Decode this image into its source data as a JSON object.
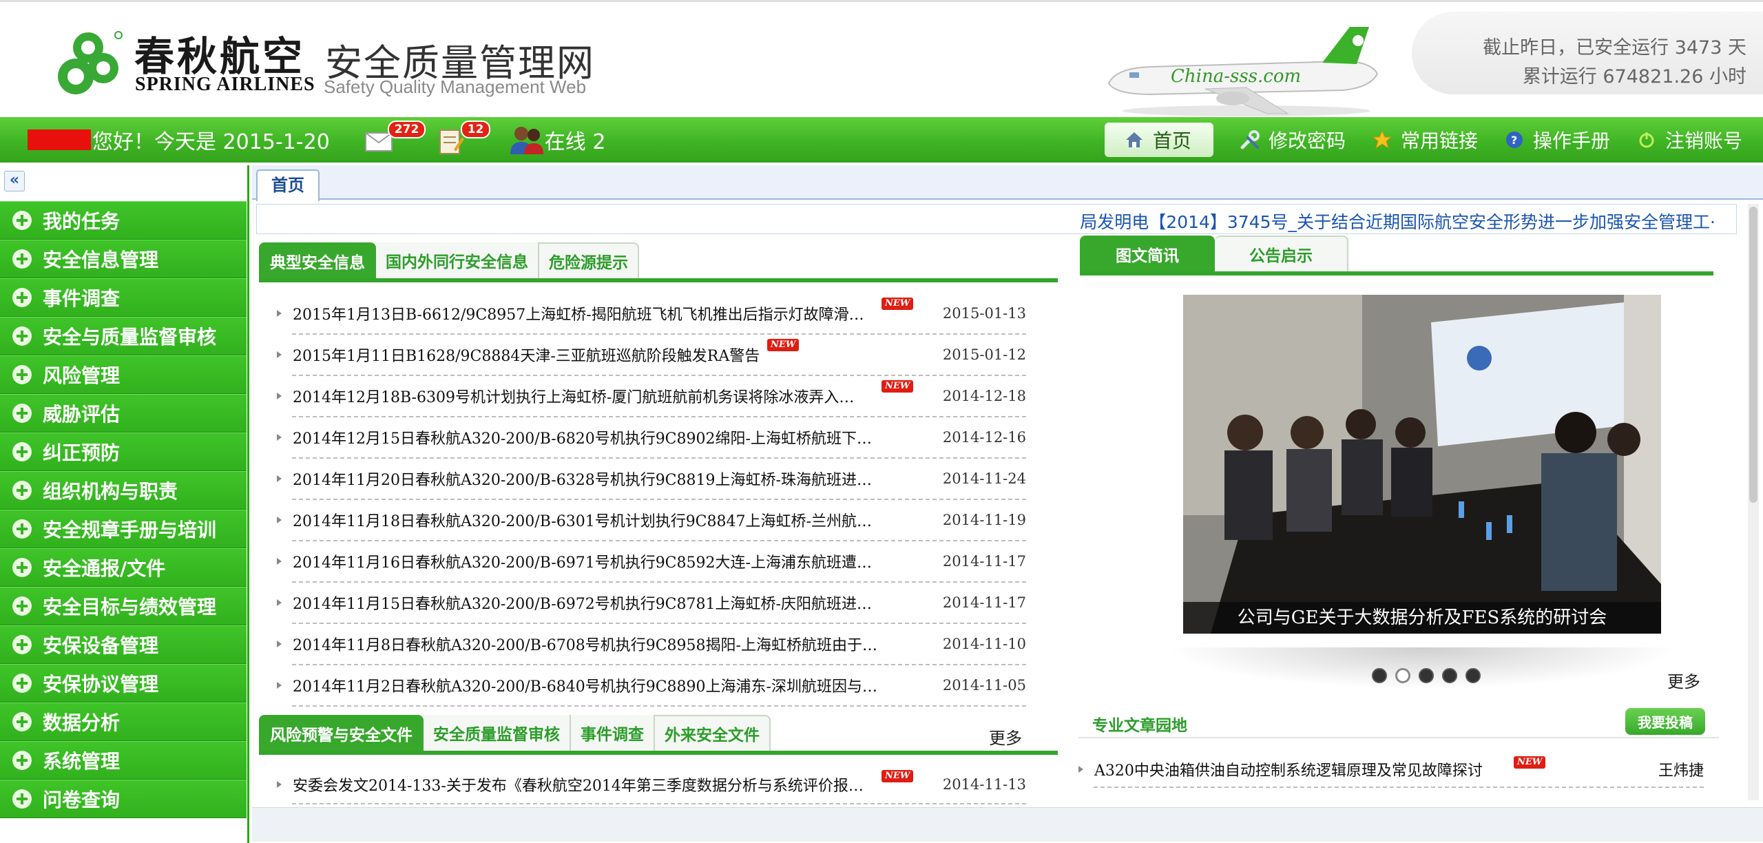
{
  "header": {
    "brand_cn": "春秋航空",
    "brand_en": "SPRING  AIRLINES",
    "site_cn": "安全质量管理网",
    "site_en": "Safety Quality Management Web",
    "stat_days": "截止昨日，已安全运行 3473 天",
    "stat_hours": "累计运行 674821.26 小时"
  },
  "navbar": {
    "greeting": "您好！今天是 2015-1-20",
    "mail_count": "272",
    "todo_count": "12",
    "online": "在线 2",
    "links": {
      "home": "首页",
      "change_password": "修改密码",
      "common_links": "常用链接",
      "manual": "操作手册",
      "logout": "注销账号"
    }
  },
  "sidebar": {
    "collapse_label": "«",
    "items": [
      "我的任务",
      "安全信息管理",
      "事件调查",
      "安全与质量监督审核",
      "风险管理",
      "威胁评估",
      "纠正预防",
      "组织机构与职责",
      "安全规章手册与培训",
      "安全通报/文件",
      "安全目标与绩效管理",
      "安保设备管理",
      "安保协议管理",
      "数据分析",
      "系统管理",
      "问卷查询"
    ]
  },
  "main": {
    "tab_home": "首页",
    "marquee": "局发明电【2014】3745号_关于结合近期国际航空安全形势进一步加强安全管理工·",
    "news_tabs": [
      "典型安全信息",
      "国内外同行安全信息",
      "危险源提示"
    ],
    "news": [
      {
        "title": "2015年1月13日B-6612/9C8957上海虹桥-揭阳航班飞机飞机推出后指示灯故障滑…",
        "date": "2015-01-13",
        "new": "NEW"
      },
      {
        "title": "2015年1月11日B1628/9C8884天津-三亚航班巡航阶段触发RA警告",
        "date": "2015-01-12",
        "new": "NEW"
      },
      {
        "title": "2014年12月18B-6309号机计划执行上海虹桥-厦门航班航前机务误将除冰液弄入A…",
        "date": "2014-12-18",
        "new": "NEW"
      },
      {
        "title": "2014年12月15日春秋航A320-200/B-6820号机执行9C8902绵阳-上海虹桥航班下降…",
        "date": "2014-12-16",
        "new": ""
      },
      {
        "title": "2014年11月20日春秋航A320-200/B-6328号机执行9C8819上海虹桥-珠海航班进近…",
        "date": "2014-11-24",
        "new": ""
      },
      {
        "title": "2014年11月18日春秋航A320-200/B-6301号机计划执行9C8847上海虹桥-兰州航班…",
        "date": "2014-11-19",
        "new": ""
      },
      {
        "title": "2014年11月16日春秋航A320-200/B-6971号机执行9C8592大连-上海浦东航班遭雷击",
        "date": "2014-11-17",
        "new": ""
      },
      {
        "title": "2014年11月15日春秋航A320-200/B-6972号机执行9C8781上海虹桥-庆阳航班进近…",
        "date": "2014-11-17",
        "new": ""
      },
      {
        "title": "2014年11月8日春秋航A320-200/B-6708号机执行9C8958揭阳-上海虹桥航班由于两…",
        "date": "2014-11-10",
        "new": ""
      },
      {
        "title": "2014年11月2日春秋航A320-200/B-6840号机执行9C8890上海浦东-深圳航班因与前…",
        "date": "2014-11-05",
        "new": ""
      }
    ],
    "risk_tabs": [
      "风险预警与安全文件",
      "安全质量监督审核",
      "事件调查",
      "外来安全文件"
    ],
    "risk_more": "更多",
    "risk_news": [
      {
        "title": "安委会发文2014-133-关于发布《春秋航空2014年第三季度数据分析与系统评价报…",
        "date": "2014-11-13",
        "new": "NEW"
      }
    ],
    "photo_tabs": [
      "图文简讯",
      "公告启示"
    ],
    "photo_caption": "公司与GE关于大数据分析及FES系统的研讨会",
    "photo_more": "更多",
    "slide_count": 5,
    "slide_active": 2,
    "article_title": "专业文章园地",
    "submit_label": "我要投稿",
    "article": {
      "title": "A320中央油箱供油自动控制系统逻辑原理及常见故障探讨",
      "author": "王炜捷",
      "new": "NEW"
    }
  },
  "colors": {
    "brand_green": "#37a82c",
    "nav_green": "#3fb424",
    "badge_red": "#e42214",
    "link_blue": "#1a55b0"
  }
}
